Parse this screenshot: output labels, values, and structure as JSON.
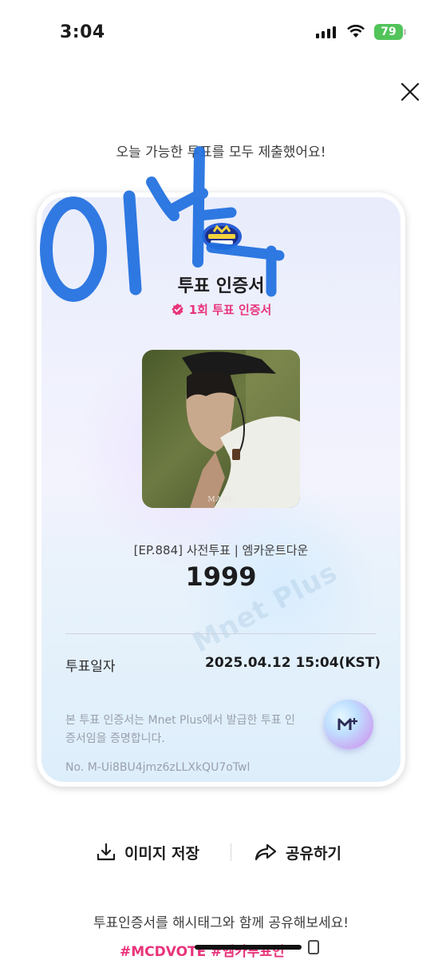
{
  "status_bar": {
    "time": "3:04",
    "battery": "79"
  },
  "header": {
    "close_icon": "close-icon"
  },
  "headline": "오늘 가능한 투표를 모두 제출했어요!",
  "certificate": {
    "logo_text": "M COUNTDOWN",
    "title": "투표 인증서",
    "badge_label": "1회 투표 인증서",
    "photo_caption": "MARK",
    "episode_line": "[EP.884] 사전투표 | 엠카운트다운",
    "vote_count": "1999",
    "date_label": "투표일자",
    "date_value": "2025.04.12 15:04(KST)",
    "notice": "본 투표 인증서는 Mnet Plus에서 발급한 투표 인증서임을 증명합니다.",
    "serial": "No. M-Ui8BU4jmz6zLLXkQU7oTwl",
    "watermark": "Mnet Plus"
  },
  "actions": {
    "save_label": "이미지 저장",
    "share_label": "공유하기"
  },
  "footer": {
    "text": "투표인증서를 해시태그와 함께 공유해보세요!",
    "hashtags": "#MCDVOTE #엠카투표인"
  },
  "colors": {
    "accent": "#e8347b",
    "battery": "#52c45a",
    "scribble": "#1f6fe0"
  }
}
